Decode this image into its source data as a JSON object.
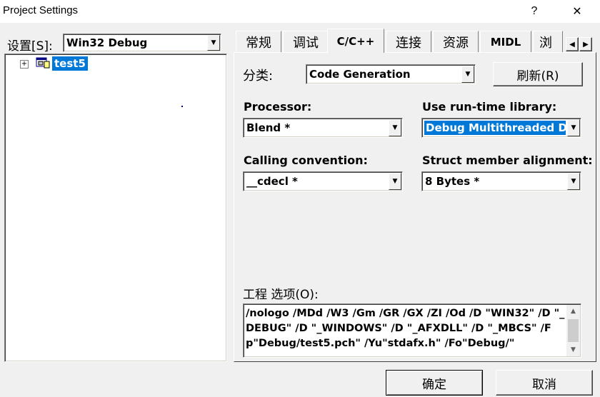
{
  "window": {
    "title": "Project Settings",
    "help_label": "?",
    "close_label": "✕"
  },
  "left": {
    "settings_label": "设置[S]:",
    "settings_value": "Win32 Debug",
    "tree_expand": "⊞",
    "tree_item": "test5"
  },
  "tabs": [
    "常规",
    "调试",
    "C/C++",
    "连接",
    "资源",
    "MIDL",
    "浏"
  ],
  "tab_scroll": {
    "left": "◀",
    "right": "▶"
  },
  "category": {
    "label": "分类:",
    "value": "Code Generation",
    "reset_button": "刷新(R)"
  },
  "processor": {
    "label": "Processor:",
    "value": "Blend *"
  },
  "runtime": {
    "label": "Use run-time library:",
    "value": "Debug Multithreaded DLL"
  },
  "calling": {
    "label": "Calling convention:",
    "value": "__cdecl *"
  },
  "alignment": {
    "label": "Struct member alignment:",
    "value": "8 Bytes *"
  },
  "options": {
    "label": "工程 选项(O):",
    "text": "/nologo /MDd /W3 /Gm /GR /GX /ZI /Od /D \"WIN32\" /D \"_DEBUG\" /D \"_WINDOWS\" /D \"_AFXDLL\" /D \"_MBCS\" /Fp\"Debug/test5.pch\" /Yu\"stdafx.h\" /Fo\"Debug/\""
  },
  "footer": {
    "ok": "确定",
    "cancel": "取消"
  },
  "icons": {
    "arrow_down": "▼",
    "arrow_up": "▲",
    "scroll_down": "▼"
  }
}
